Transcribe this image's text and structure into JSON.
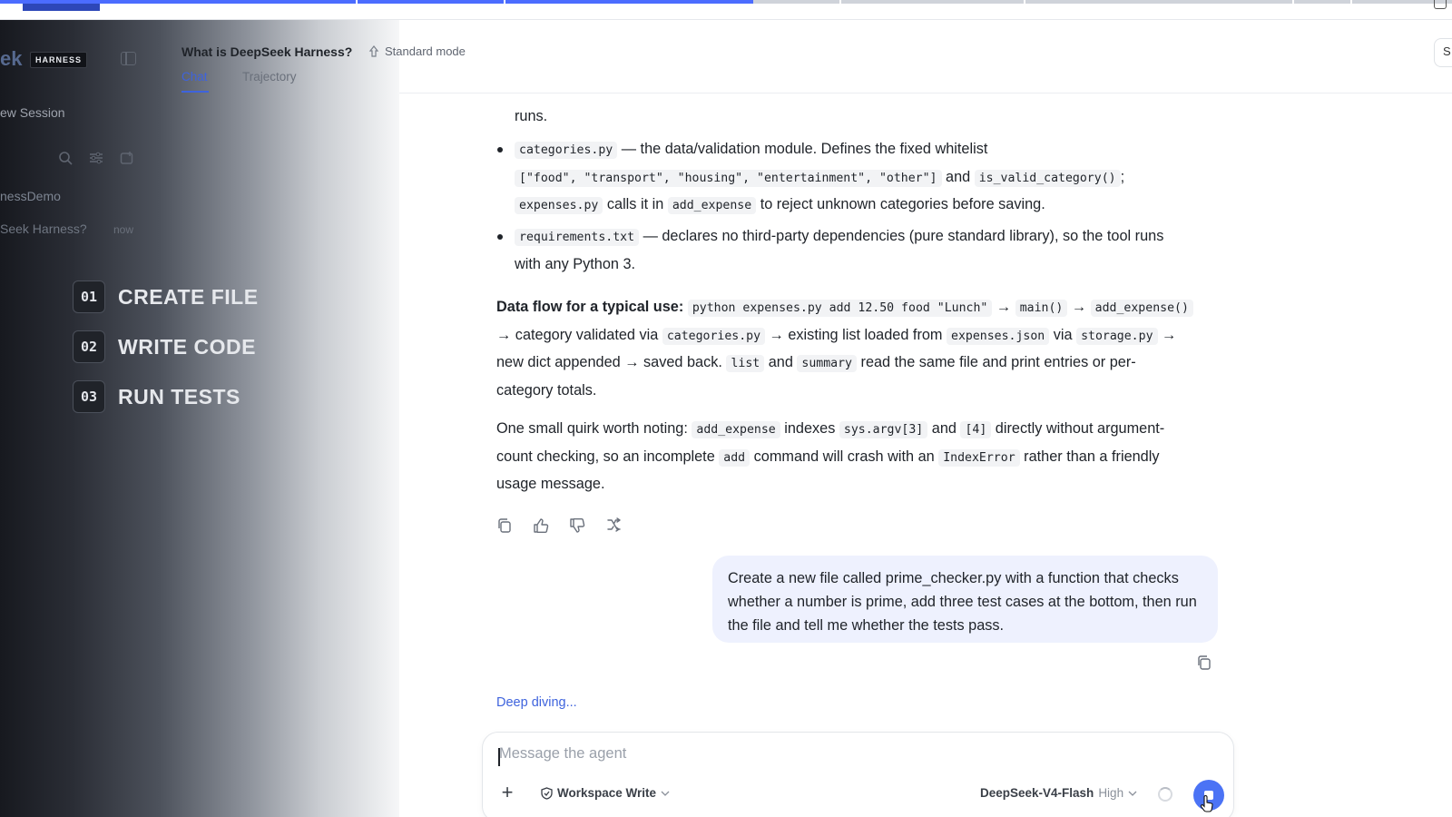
{
  "sidebar": {
    "logo_partial": "ek",
    "logo_badge": "HARNESS",
    "new_session": "ew Session",
    "project": "nessDemo",
    "session_title": "Seek Harness?",
    "session_time": "now",
    "steps": [
      {
        "num": "01",
        "label": "CREATE FILE"
      },
      {
        "num": "02",
        "label": "WRITE CODE"
      },
      {
        "num": "03",
        "label": "RUN TESTS"
      }
    ]
  },
  "header": {
    "title": "What is DeepSeek Harness?",
    "mode": "Standard mode",
    "tabs": [
      "Chat",
      "Trajectory"
    ],
    "right_edge_char": "S"
  },
  "message": {
    "runs_tail": "runs.",
    "bullet_categories": {
      "code": "categories.py",
      "text1": " — the data/validation module. Defines the fixed whitelist",
      "code_list": "[\"food\", \"transport\", \"housing\", \"entertainment\", \"other\"]",
      "and": " and ",
      "code_fn": "is_valid_category()",
      "semi": ";",
      "code_exp": "expenses.py",
      "calls": " calls it in ",
      "code_add": "add_expense",
      "tail": " to reject unknown categories before saving."
    },
    "bullet_requirements": {
      "code": "requirements.txt",
      "text1": " — declares no third-party dependencies (pure standard library), so the tool runs",
      "text2": "with any Python 3."
    },
    "dataflow": {
      "label": "Data flow for a typical use:",
      "cmd": "python expenses.py add 12.50 food \"Lunch\"",
      "arrow": " → ",
      "main": "main()",
      "add": "add_expense()",
      "l2a": "→ category validated via ",
      "cat": "categories.py",
      "l2b": " → existing list loaded from ",
      "json": "expenses.json",
      "via": " via ",
      "storage": "storage.py",
      "l2c": " →",
      "l3a": "new dict appended → saved back. ",
      "list": "list",
      "and": " and ",
      "summary": "summary",
      "l3b": " read the same file and print entries or per-",
      "l4": "category totals."
    },
    "quirk": {
      "a": "One small quirk worth noting: ",
      "add": "add_expense",
      "b": " indexes ",
      "argv": "sys.argv[3]",
      "c": " and ",
      "four": "[4]",
      "d": " directly without argument-",
      "e": "count checking, so an incomplete ",
      "addcmd": "add",
      "f": " command will crash with an ",
      "err": "IndexError",
      "g": " rather than a friendly",
      "h": "usage message."
    }
  },
  "user_message": "Create a new file called prime_checker.py with a function that checks whether a number is prime, add three test cases at the bottom, then run the file and tell me whether the tests pass.",
  "status": "Deep diving...",
  "composer": {
    "placeholder": "Message the agent",
    "workspace": "Workspace Write",
    "model": "DeepSeek-V4-Flash",
    "effort": "High"
  },
  "colors": {
    "accent": "#3e63dd",
    "bubble": "#eef1fe",
    "send": "#4b73f5"
  },
  "top_progress": 0.52
}
